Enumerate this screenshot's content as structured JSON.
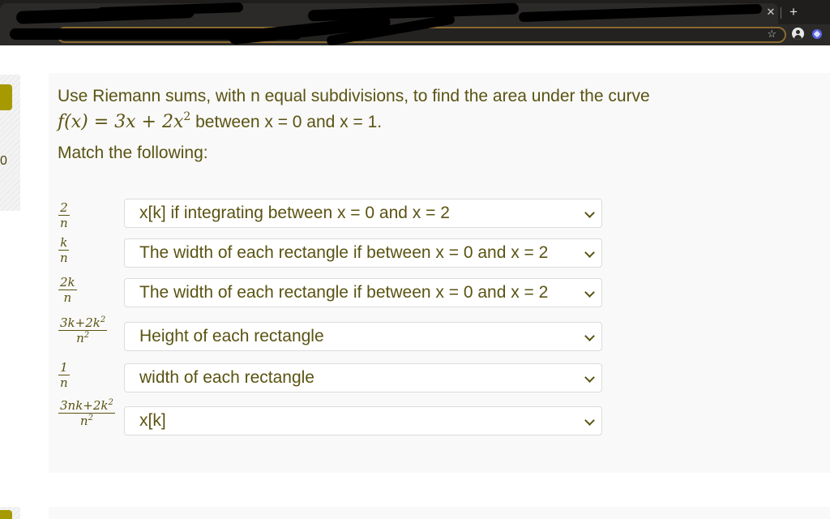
{
  "browser": {
    "tab_close_icon": "close-icon",
    "new_tab_icon": "plus-icon",
    "bookmark_icon": "star-icon",
    "profile_icon": "account-circle-icon",
    "extension_icon": "extension-icon",
    "accent_color": "#8a6a2f"
  },
  "sidebar": {
    "question_number": "0",
    "flag_color": "#a69a00"
  },
  "question": {
    "prompt_line1": "Use Riemann sums, with n equal subdivisions, to find the area under the curve",
    "function_lhs": "f(x) = 3x + 2x",
    "function_exponent": "2",
    "prompt_line2": " between x = 0 and x = 1.",
    "match_label": "Match the following:",
    "text_color": "#5a5312",
    "items": [
      {
        "num": "2",
        "num_sup": "",
        "den": "n",
        "den_sup": "",
        "selected": "x[k] if integrating between x = 0 and x = 2"
      },
      {
        "num": "k",
        "num_sup": "",
        "den": "n",
        "den_sup": "",
        "selected": "The width of each rectangle if between x = 0 and x = 2"
      },
      {
        "num": "2k",
        "num_sup": "",
        "den": "n",
        "den_sup": "",
        "selected": "The width of each rectangle if between x = 0 and x = 2"
      },
      {
        "num": "3k+2k",
        "num_sup": "2",
        "den": "n",
        "den_sup": "2",
        "selected": "Height of each rectangle"
      },
      {
        "num": "1",
        "num_sup": "",
        "den": "n",
        "den_sup": "",
        "selected": "width of each rectangle"
      },
      {
        "num": "3nk+2k",
        "num_sup": "2",
        "den": "n",
        "den_sup": "2",
        "selected": "x[k]"
      }
    ]
  }
}
